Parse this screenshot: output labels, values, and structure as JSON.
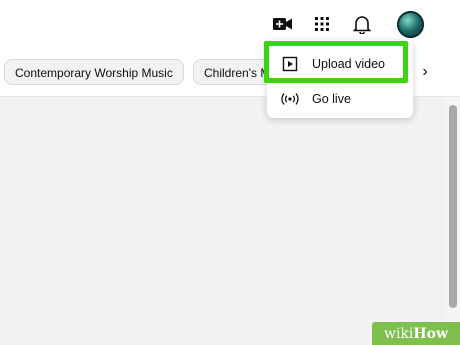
{
  "header": {
    "icons": [
      "create-video-icon",
      "apps-grid-icon",
      "notifications-bell-icon",
      "avatar"
    ]
  },
  "chips": [
    {
      "label": "Contemporary Worship Music"
    },
    {
      "label": "Children's M"
    }
  ],
  "menu": {
    "items": [
      {
        "label": "Upload video",
        "icon": "play-square-icon"
      },
      {
        "label": "Go live",
        "icon": "live-broadcast-icon"
      }
    ],
    "highlight_color": "#3cd40c"
  },
  "watermark": {
    "part1": "wiki",
    "part2": "How"
  },
  "colors": {
    "background": "#f2f2f2",
    "header": "#ffffff",
    "watermark": "#7fbf4d"
  }
}
